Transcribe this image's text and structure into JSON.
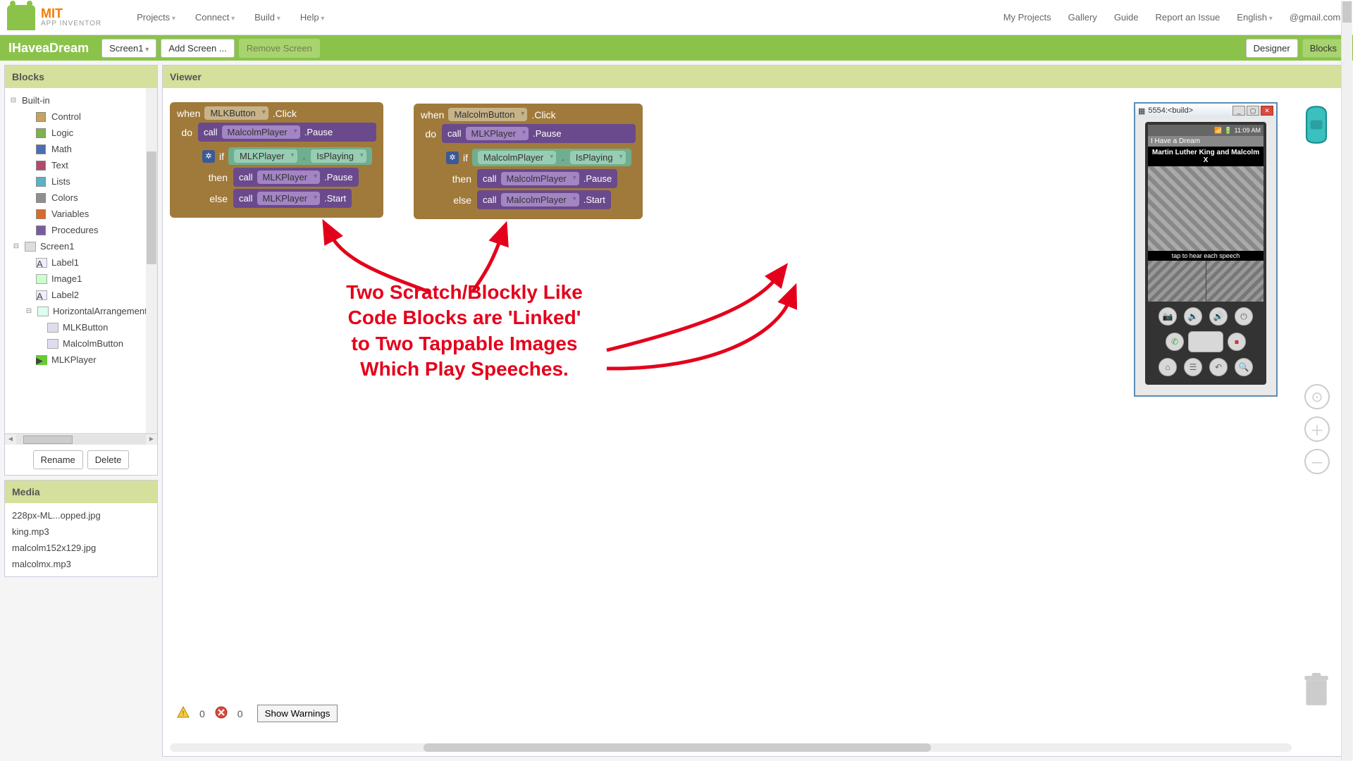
{
  "brand": {
    "name": "MIT",
    "sub": "APP INVENTOR"
  },
  "menu": {
    "left": [
      "Projects",
      "Connect",
      "Build",
      "Help"
    ],
    "right": [
      "My Projects",
      "Gallery",
      "Guide",
      "Report an Issue"
    ],
    "lang": "English",
    "user": "@gmail.com"
  },
  "projbar": {
    "title": "IHaveaDream",
    "screen_dd": "Screen1",
    "add": "Add Screen ...",
    "remove": "Remove Screen",
    "designer": "Designer",
    "blocks": "Blocks"
  },
  "panels": {
    "blocks": "Blocks",
    "viewer": "Viewer",
    "media": "Media"
  },
  "tree": {
    "builtin": "Built-in",
    "cats": [
      {
        "label": "Control",
        "color": "#c7a35b"
      },
      {
        "label": "Logic",
        "color": "#7fb24a"
      },
      {
        "label": "Math",
        "color": "#4a6fb2"
      },
      {
        "label": "Text",
        "color": "#b24a6d"
      },
      {
        "label": "Lists",
        "color": "#5bb2c7"
      },
      {
        "label": "Colors",
        "color": "#8f8f8f"
      },
      {
        "label": "Variables",
        "color": "#d96b2a"
      },
      {
        "label": "Procedures",
        "color": "#7a5ba0"
      }
    ],
    "screen": "Screen1",
    "components": [
      "Label1",
      "Image1",
      "Label2"
    ],
    "arrangement": "HorizontalArrangement",
    "arr_children": [
      "MLKButton",
      "MalcolmButton"
    ],
    "player": "MLKPlayer",
    "rename": "Rename",
    "delete": "Delete"
  },
  "media": [
    "228px-ML...opped.jpg",
    "king.mp3",
    "malcolm152x129.jpg",
    "malcolmx.mp3"
  ],
  "stack1": {
    "when": "when",
    "btn": "MLKButton",
    "evt": ".Click",
    "do": "do",
    "call": "call",
    "p1": "MalcolmPlayer",
    "m1": ".Pause",
    "if": "if",
    "cond_p": "MLKPlayer",
    "cond_m": "IsPlaying",
    "then": "then",
    "tp": "MLKPlayer",
    "tm": ".Pause",
    "else": "else",
    "ep": "MLKPlayer",
    "em": ".Start"
  },
  "stack2": {
    "when": "when",
    "btn": "MalcolmButton",
    "evt": ".Click",
    "do": "do",
    "call": "call",
    "p1": "MLKPlayer",
    "m1": ".Pause",
    "if": "if",
    "cond_p": "MalcolmPlayer",
    "cond_m": "IsPlaying",
    "then": "then",
    "tp": "MalcolmPlayer",
    "tm": ".Pause",
    "else": "else",
    "ep": "MalcolmPlayer",
    "em": ".Start"
  },
  "annotation": {
    "l1": "Two Scratch/Blockly Like",
    "l2": "Code Blocks are 'Linked'",
    "l3": "to Two Tappable Images",
    "l4": "Which Play Speeches."
  },
  "emu": {
    "title": "5554:<build>",
    "time": "11:09 AM",
    "app_title": "I Have a Dream",
    "heading": "Martin Luther King and Malcolm X",
    "tap": "tap to hear each speech"
  },
  "warnbar": {
    "warn_n": "0",
    "err_n": "0",
    "show": "Show Warnings"
  }
}
